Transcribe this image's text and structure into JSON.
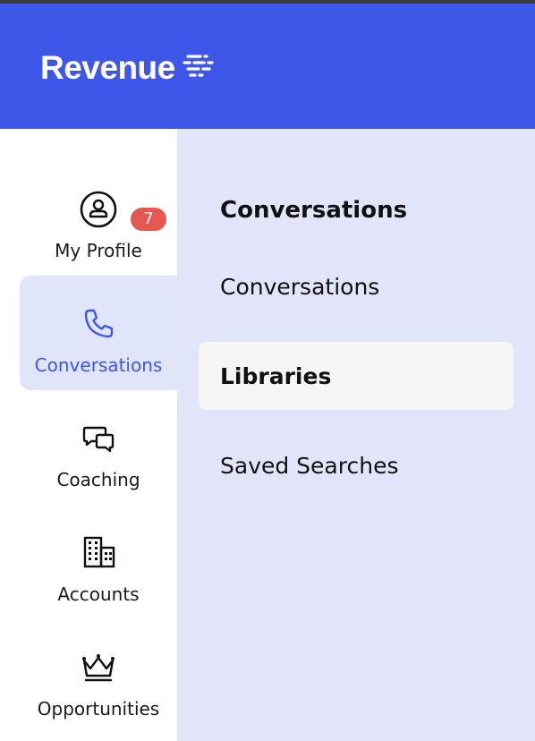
{
  "brand": {
    "name": "Revenue",
    "logo_icon": "revenue-lines-icon"
  },
  "colors": {
    "primary": "#3f57e8",
    "panel_bg": "#e2e5fa",
    "badge": "#e5574f"
  },
  "sidebar": {
    "items": [
      {
        "label": "My Profile",
        "icon": "user-circle-icon",
        "badge": "7",
        "active": false
      },
      {
        "label": "Conversations",
        "icon": "phone-icon",
        "active": true
      },
      {
        "label": "Coaching",
        "icon": "chat-bubbles-icon",
        "active": false
      },
      {
        "label": "Accounts",
        "icon": "buildings-icon",
        "active": false
      },
      {
        "label": "Opportunities",
        "icon": "crown-icon",
        "active": false
      }
    ]
  },
  "panel": {
    "title": "Conversations",
    "items": [
      {
        "label": "Conversations",
        "selected": false
      },
      {
        "label": "Libraries",
        "selected": true
      },
      {
        "label": "Saved Searches",
        "selected": false
      }
    ]
  }
}
